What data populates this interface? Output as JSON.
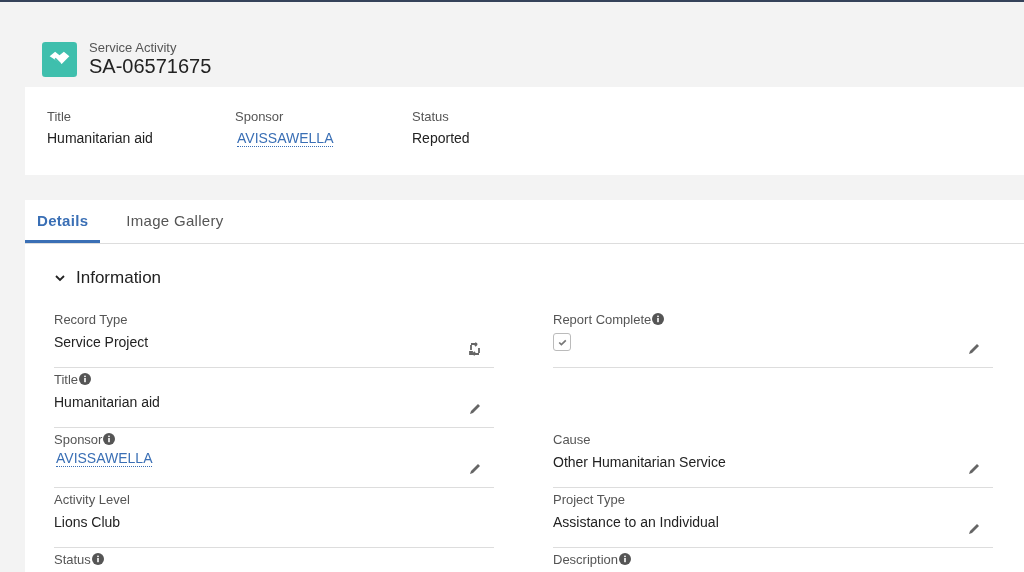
{
  "header": {
    "object_type": "Service Activity",
    "record_name": "SA-06571675"
  },
  "highlights": [
    {
      "label": "Title",
      "value": "Humanitarian aid",
      "kind": "text"
    },
    {
      "label": "Sponsor",
      "value": "AVISSAWELLA",
      "kind": "link"
    },
    {
      "label": "Status",
      "value": "Reported",
      "kind": "text"
    }
  ],
  "tabs": [
    {
      "label": "Details",
      "selected": true
    },
    {
      "label": "Image Gallery",
      "selected": false
    }
  ],
  "section": {
    "title": "Information",
    "expanded": true
  },
  "rows": [
    {
      "left": {
        "label": "Record Type",
        "info": false,
        "kind": "text",
        "value": "Service Project",
        "editable": false,
        "record_type_switch": true
      },
      "right": {
        "label": "Report Complete",
        "info": true,
        "kind": "checkbox",
        "checked": true,
        "editable": true
      }
    },
    {
      "left": {
        "label": "Title",
        "info": true,
        "kind": "text",
        "value": "Humanitarian aid",
        "editable": true
      }
    },
    {
      "left": {
        "label": "Sponsor",
        "info": true,
        "kind": "link",
        "value": "AVISSAWELLA",
        "editable": true
      },
      "right": {
        "label": "Cause",
        "info": false,
        "kind": "text",
        "value": "Other Humanitarian Service",
        "editable": true
      }
    },
    {
      "left": {
        "label": "Activity Level",
        "info": false,
        "kind": "text",
        "value": "Lions Club",
        "editable": false
      },
      "right": {
        "label": "Project Type",
        "info": false,
        "kind": "text",
        "value": "Assistance to an Individual",
        "editable": true
      }
    },
    {
      "left": {
        "label": "Status",
        "info": true,
        "kind": "cut"
      },
      "right": {
        "label": "Description",
        "info": true,
        "kind": "cut"
      }
    }
  ]
}
